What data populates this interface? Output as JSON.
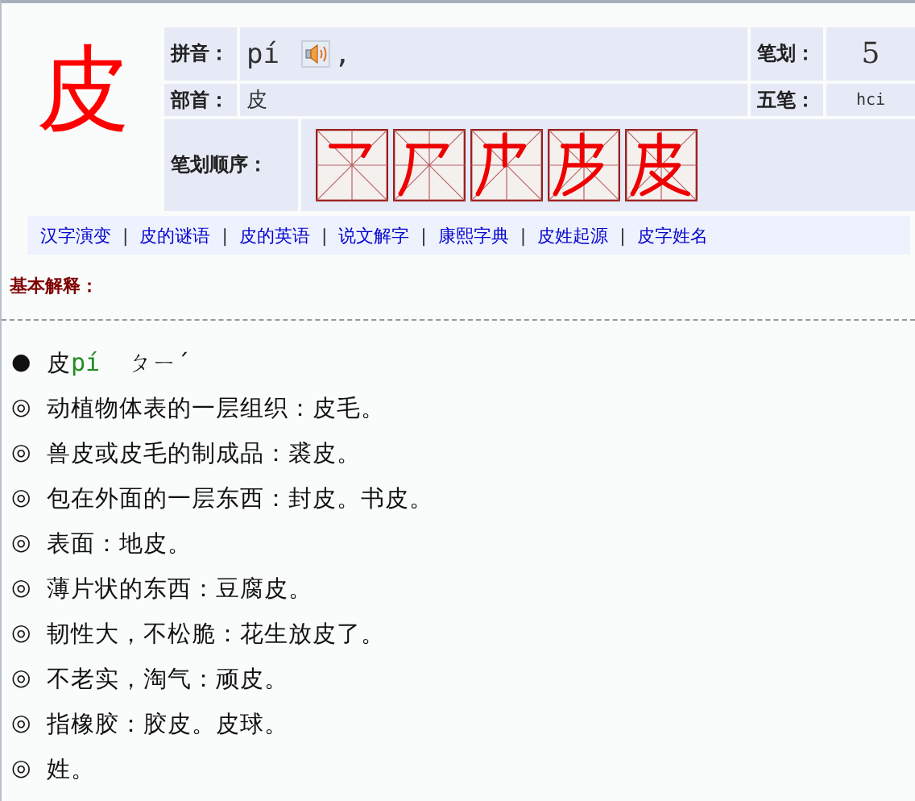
{
  "character": "皮",
  "pinyin": {
    "label": "拼音：",
    "value": "pí",
    "suffix": ","
  },
  "strokes": {
    "label": "笔划：",
    "value": "5"
  },
  "radical": {
    "label": "部首：",
    "value": "皮"
  },
  "wubi": {
    "label": "五笔：",
    "value": "hci"
  },
  "stroke_order": {
    "label": "笔划顺序：",
    "frames": [
      {
        "kind": "frame"
      },
      {
        "kind": "frame"
      },
      {
        "kind": "frame"
      },
      {
        "kind": "frame"
      },
      {
        "kind": "frame"
      }
    ]
  },
  "links": [
    "汉字演变",
    "皮的谜语",
    "皮的英语",
    "说文解字",
    "康熙字典",
    "皮姓起源",
    "皮字姓名"
  ],
  "link_separator": "|",
  "section_title": "基本解释：",
  "entries": [
    {
      "kind": "heading",
      "bullet": "●",
      "char": "皮",
      "pinyin": "pí",
      "zhuyin": "ㄆㄧˊ"
    },
    {
      "kind": "sense",
      "bullet": "◎",
      "text": "动植物体表的一层组织：皮毛。"
    },
    {
      "kind": "sense",
      "bullet": "◎",
      "text": "兽皮或皮毛的制成品：裘皮。"
    },
    {
      "kind": "sense",
      "bullet": "◎",
      "text": "包在外面的一层东西：封皮。书皮。"
    },
    {
      "kind": "sense",
      "bullet": "◎",
      "text": "表面：地皮。"
    },
    {
      "kind": "sense",
      "bullet": "◎",
      "text": "薄片状的东西：豆腐皮。"
    },
    {
      "kind": "sense",
      "bullet": "◎",
      "text": "韧性大，不松脆：花生放皮了。"
    },
    {
      "kind": "sense",
      "bullet": "◎",
      "text": "不老实，淘气：顽皮。"
    },
    {
      "kind": "sense",
      "bullet": "◎",
      "text": "指橡胶：胶皮。皮球。"
    },
    {
      "kind": "sense",
      "bullet": "◎",
      "text": "姓。"
    }
  ]
}
